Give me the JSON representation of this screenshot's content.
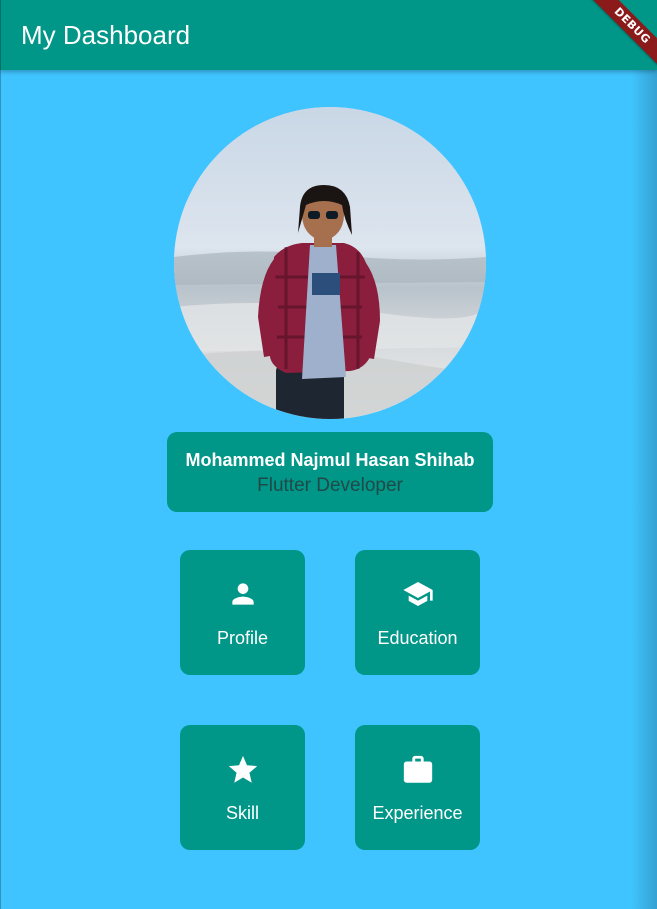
{
  "app_bar": {
    "title": "My Dashboard",
    "debug_label": "DEBUG",
    "color": "#009688"
  },
  "background_color": "#40C4FF",
  "profile": {
    "name": "Mohammed Najmul Hasan Shihab",
    "role": "Flutter Developer"
  },
  "tiles": [
    {
      "label": "Profile",
      "icon": "person-icon"
    },
    {
      "label": "Education",
      "icon": "school-icon"
    },
    {
      "label": "Skill",
      "icon": "star-icon"
    },
    {
      "label": "Experience",
      "icon": "briefcase-icon"
    }
  ]
}
